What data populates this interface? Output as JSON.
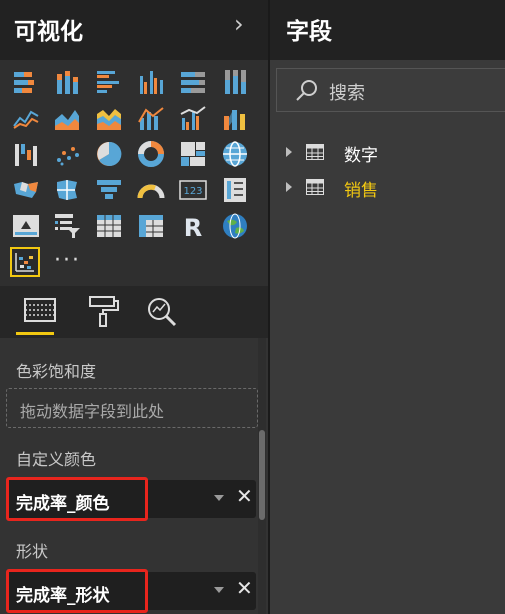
{
  "visualizations": {
    "title": "可视化",
    "collapse_glyph": "›",
    "more_glyph": "···",
    "icons": [
      "stacked-bar-icon",
      "stacked-column-icon",
      "clustered-bar-icon",
      "clustered-column-icon",
      "100-bar-icon",
      "100-column-icon",
      "line-chart-icon",
      "area-chart-icon",
      "stacked-area-icon",
      "line-column-icon",
      "line-clustered-column-icon",
      "ribbon-chart-icon",
      "waterfall-icon",
      "scatter-icon",
      "pie-icon",
      "donut-icon",
      "treemap-icon",
      "globe-map-icon",
      "filled-map-icon",
      "shape-map-icon",
      "funnel-icon",
      "gauge-icon",
      "card-icon",
      "multirow-card-icon",
      "kpi-icon",
      "slicer-icon",
      "table-icon",
      "matrix-icon",
      "r-visual-icon",
      "arcgis-icon",
      "custom-visual-icon"
    ],
    "r_letter": "R",
    "card_text": "123"
  },
  "wells": {
    "saturation_label": "色彩饱和度",
    "saturation_placeholder": "拖动数据字段到此处",
    "custom_color_label": "自定义颜色",
    "custom_color_field": "完成率_颜色",
    "shape_label": "形状",
    "shape_field": "完成率_形状",
    "remove_glyph": "✕"
  },
  "fields": {
    "title": "字段",
    "search_placeholder": "搜索",
    "tables": [
      {
        "label": "数字"
      },
      {
        "label": "销售"
      }
    ]
  },
  "colors": {
    "accent_yellow": "#f2c811",
    "highlight_red": "#e8251d",
    "table_label_white": "#ffffff",
    "table_label_yellow": "#f2c811"
  }
}
